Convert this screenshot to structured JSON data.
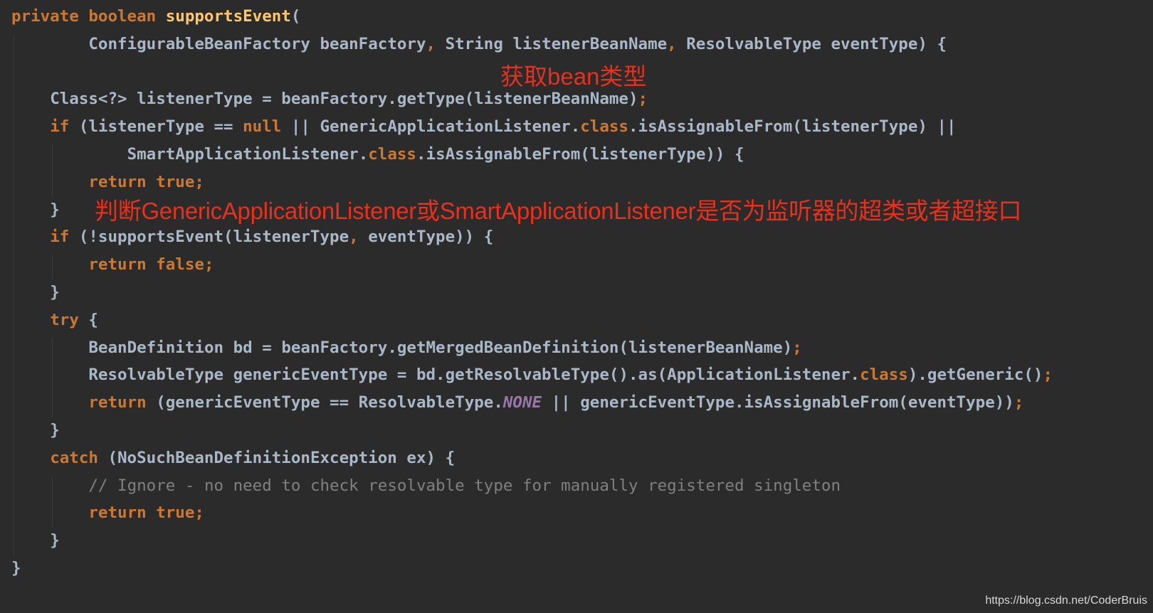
{
  "editor": {
    "colors": {
      "background": "#2b2b2b",
      "keyword": "#cc7832",
      "method_declaration": "#ffc66d",
      "identifier": "#a9b7c6",
      "constant": "#9876aa",
      "comment": "#808080",
      "annotation": "#e8301c"
    },
    "lines": [
      {
        "indent": 0,
        "tokens": [
          {
            "t": "kw",
            "v": "private boolean "
          },
          {
            "t": "fn",
            "v": "supportsEvent"
          },
          {
            "t": "id",
            "v": "("
          }
        ]
      },
      {
        "indent": 4,
        "tokens": [
          {
            "t": "id",
            "v": "ConfigurableBeanFactory beanFactory"
          },
          {
            "t": "kw",
            "v": ", "
          },
          {
            "t": "id",
            "v": "String listenerBeanName"
          },
          {
            "t": "kw",
            "v": ", "
          },
          {
            "t": "id",
            "v": "ResolvableType eventType) {"
          }
        ]
      },
      {
        "indent": 0,
        "tokens": []
      },
      {
        "indent": 2,
        "tokens": [
          {
            "t": "id",
            "v": "Class<?> listenerType = beanFactory.getType(listenerBeanName)"
          },
          {
            "t": "kw",
            "v": ";"
          }
        ]
      },
      {
        "indent": 2,
        "tokens": [
          {
            "t": "kw",
            "v": "if "
          },
          {
            "t": "id",
            "v": "(listenerType == "
          },
          {
            "t": "kw",
            "v": "null "
          },
          {
            "t": "id",
            "v": "|| GenericApplicationListener."
          },
          {
            "t": "kw",
            "v": "class"
          },
          {
            "t": "id",
            "v": ".isAssignableFrom(listenerType) ||"
          }
        ]
      },
      {
        "indent": 6,
        "tokens": [
          {
            "t": "id",
            "v": "SmartApplicationListener."
          },
          {
            "t": "kw",
            "v": "class"
          },
          {
            "t": "id",
            "v": ".isAssignableFrom(listenerType)) {"
          }
        ]
      },
      {
        "indent": 4,
        "tokens": [
          {
            "t": "kw",
            "v": "return true;"
          }
        ]
      },
      {
        "indent": 2,
        "tokens": [
          {
            "t": "id",
            "v": "}"
          }
        ]
      },
      {
        "indent": 2,
        "tokens": [
          {
            "t": "kw",
            "v": "if "
          },
          {
            "t": "id",
            "v": "(!supportsEvent(listenerType"
          },
          {
            "t": "kw",
            "v": ", "
          },
          {
            "t": "id",
            "v": "eventType)) {"
          }
        ]
      },
      {
        "indent": 4,
        "tokens": [
          {
            "t": "kw",
            "v": "return false;"
          }
        ]
      },
      {
        "indent": 2,
        "tokens": [
          {
            "t": "id",
            "v": "}"
          }
        ]
      },
      {
        "indent": 2,
        "tokens": [
          {
            "t": "kw",
            "v": "try "
          },
          {
            "t": "id",
            "v": "{"
          }
        ]
      },
      {
        "indent": 4,
        "tokens": [
          {
            "t": "id",
            "v": "BeanDefinition bd = beanFactory.getMergedBeanDefinition(listenerBeanName)"
          },
          {
            "t": "kw",
            "v": ";"
          }
        ]
      },
      {
        "indent": 4,
        "tokens": [
          {
            "t": "id",
            "v": "ResolvableType genericEventType = bd.getResolvableType().as(ApplicationListener."
          },
          {
            "t": "kw",
            "v": "class"
          },
          {
            "t": "id",
            "v": ").getGeneric()"
          },
          {
            "t": "kw",
            "v": ";"
          }
        ]
      },
      {
        "indent": 4,
        "tokens": [
          {
            "t": "kw",
            "v": "return "
          },
          {
            "t": "id",
            "v": "(genericEventType == ResolvableType."
          },
          {
            "t": "konst",
            "v": "NONE"
          },
          {
            "t": "id",
            "v": " || genericEventType.isAssignableFrom(eventType))"
          },
          {
            "t": "kw",
            "v": ";"
          }
        ]
      },
      {
        "indent": 2,
        "tokens": [
          {
            "t": "id",
            "v": "}"
          }
        ]
      },
      {
        "indent": 2,
        "tokens": [
          {
            "t": "kw",
            "v": "catch "
          },
          {
            "t": "id",
            "v": "(NoSuchBeanDefinitionException ex) {"
          }
        ]
      },
      {
        "indent": 4,
        "tokens": [
          {
            "t": "cmt",
            "v": "// Ignore - no need to check resolvable type for manually registered singleton"
          }
        ]
      },
      {
        "indent": 4,
        "tokens": [
          {
            "t": "kw",
            "v": "return true;"
          }
        ]
      },
      {
        "indent": 2,
        "tokens": [
          {
            "t": "id",
            "v": "}"
          }
        ]
      },
      {
        "indent": 0,
        "tokens": [
          {
            "t": "id",
            "v": "}"
          }
        ]
      }
    ]
  },
  "annotations": {
    "get_bean_type": "获取bean类型",
    "check_supertype": "判断GenericApplicationListener或SmartApplicationListener是否为监听器的超类或者超接口"
  },
  "watermark": "https://blog.csdn.net/CoderBruis"
}
